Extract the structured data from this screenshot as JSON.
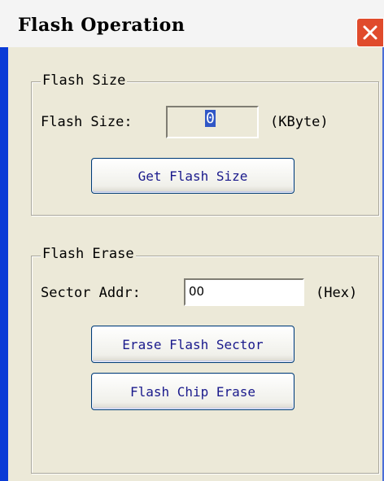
{
  "window": {
    "title": "Flash Operation"
  },
  "flash_size_group": {
    "title": "Flash Size",
    "label": "Flash Size:",
    "value": "0",
    "unit": "(KByte)",
    "button_label": "Get Flash Size"
  },
  "flash_erase_group": {
    "title": "Flash Erase",
    "sector_label": "Sector Addr:",
    "sector_value": "00",
    "unit": "(Hex)",
    "erase_sector_label": "Erase Flash Sector",
    "chip_erase_label": "Flash Chip Erase"
  }
}
